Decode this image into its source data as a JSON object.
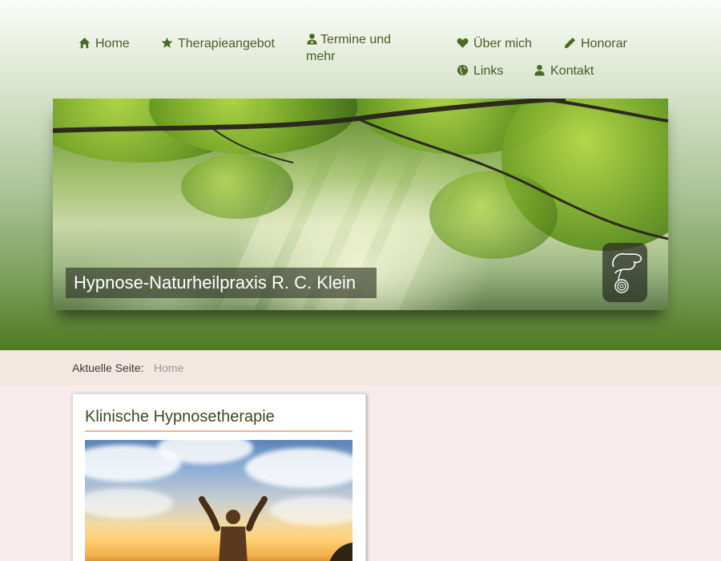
{
  "nav": {
    "items": [
      {
        "label": "Home",
        "icon": "home-icon"
      },
      {
        "label": "Therapieangebot",
        "icon": "star-icon"
      },
      {
        "label": "Termine und mehr",
        "icon": "user-md-icon"
      },
      {
        "label": "Über mich",
        "icon": "heart-icon"
      },
      {
        "label": "Honorar",
        "icon": "pencil-icon"
      },
      {
        "label": "Links",
        "icon": "globe-icon"
      },
      {
        "label": "Kontakt",
        "icon": "user-icon"
      }
    ]
  },
  "banner": {
    "title": "Hypnose-Naturheilpraxis R. C. Klein"
  },
  "breadcrumb": {
    "label": "Aktuelle Seite:",
    "current": "Home"
  },
  "card": {
    "title": "Klinische Hypnosetherapie"
  },
  "colors": {
    "nav_text": "#4a5d2a",
    "accent_rule": "#f2b48a",
    "page_bg": "#f7eceb"
  }
}
